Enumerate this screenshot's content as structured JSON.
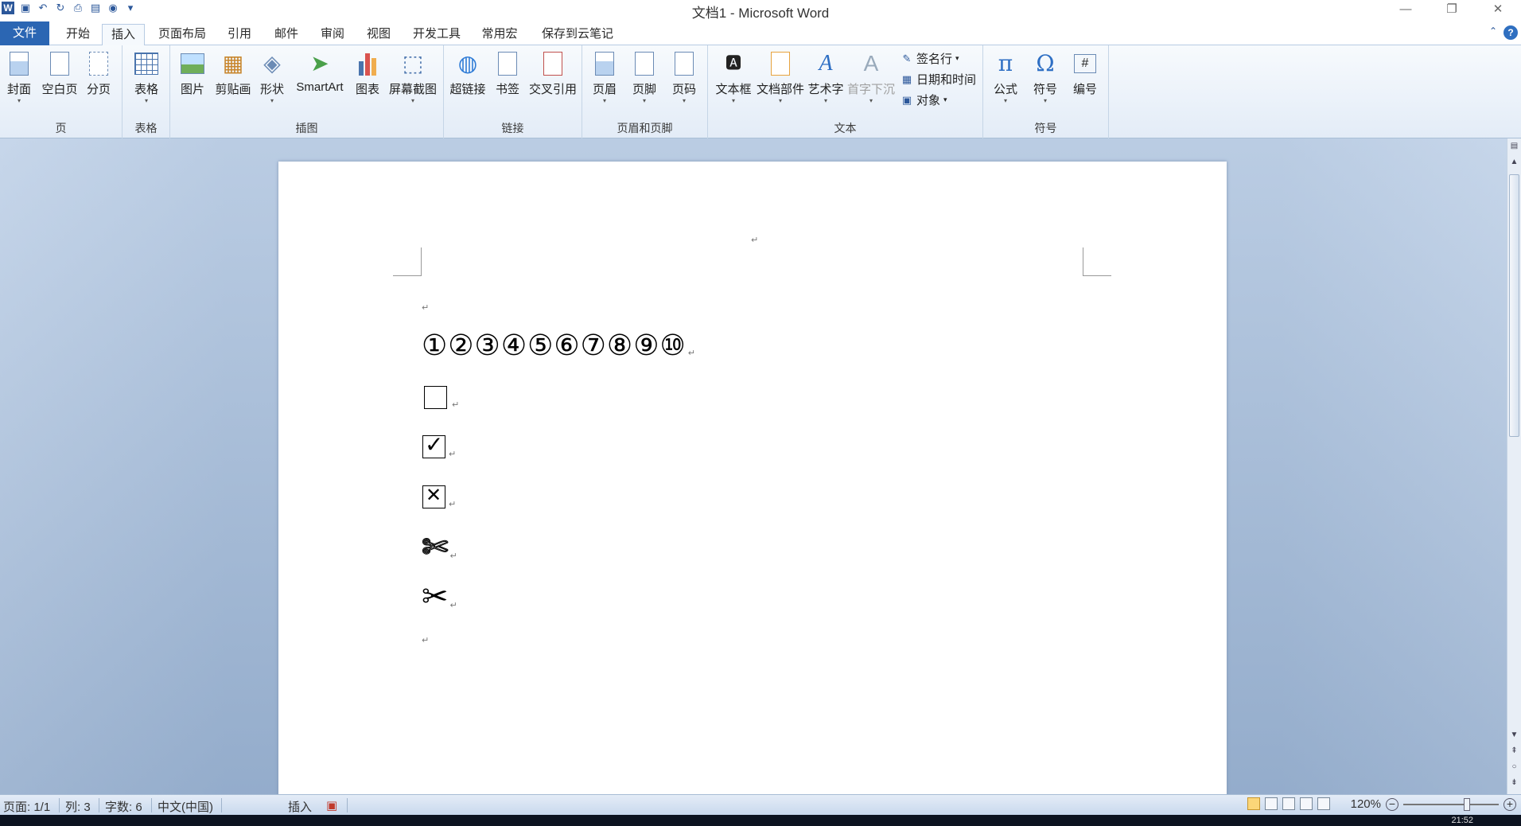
{
  "window": {
    "title": "文档1 - Microsoft Word"
  },
  "tabs": {
    "file": "文件",
    "items": [
      "开始",
      "插入",
      "页面布局",
      "引用",
      "邮件",
      "审阅",
      "视图",
      "开发工具",
      "常用宏",
      "保存到云笔记"
    ],
    "active": "插入"
  },
  "ribbon": {
    "groups": {
      "pages": {
        "label": "页",
        "cover": "封面",
        "blank": "空白页",
        "break": "分页"
      },
      "tables": {
        "label": "表格",
        "table": "表格"
      },
      "illustrations": {
        "label": "插图",
        "picture": "图片",
        "clipart": "剪贴画",
        "shapes": "形状",
        "smartart": "SmartArt",
        "chart": "图表",
        "screenshot": "屏幕截图"
      },
      "links": {
        "label": "链接",
        "hyperlink": "超链接",
        "bookmark": "书签",
        "crossref": "交叉引用"
      },
      "headerfooter": {
        "label": "页眉和页脚",
        "header": "页眉",
        "footer": "页脚",
        "pagenumber": "页码"
      },
      "text": {
        "label": "文本",
        "textbox": "文本框",
        "quickparts": "文档部件",
        "wordart": "艺术字",
        "dropcap": "首字下沉",
        "signature": "签名行",
        "datetime": "日期和时间",
        "object": "对象"
      },
      "symbols": {
        "label": "符号",
        "equation": "公式",
        "symbol": "符号",
        "numbering": "编号"
      }
    }
  },
  "document": {
    "circled_numbers": "①②③④⑤⑥⑦⑧⑨⑩",
    "scissors_outline": "✄",
    "scissors_solid": "✂"
  },
  "statusbar": {
    "page": "页面: 1/1",
    "column": "列: 3",
    "words": "字数: 6",
    "language": "中文(中国)",
    "mode": "插入",
    "zoom": "120%"
  },
  "taskbar": {
    "clock": "21:52"
  },
  "icons": [
    "save-icon",
    "undo-icon",
    "redo-icon",
    "help-icon",
    "pi-icon",
    "omega-icon"
  ]
}
